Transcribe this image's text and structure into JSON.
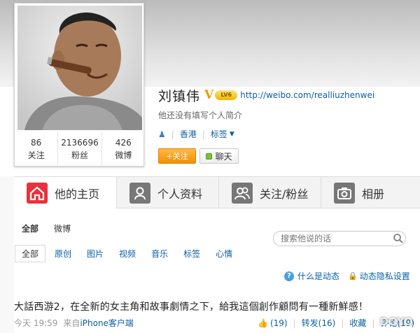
{
  "profile": {
    "name": "刘镇伟",
    "verified_badge": "V",
    "level_badge": "LV6",
    "url": "http://weibo.com/realliuzhenwei",
    "bio": "他还没有填写个人简介",
    "location": "香港",
    "tags_label": "标签",
    "follow_label": "+关注",
    "chat_label": "聊天"
  },
  "stats": [
    {
      "num": "86",
      "label": "关注"
    },
    {
      "num": "2136696",
      "label": "粉丝"
    },
    {
      "num": "426",
      "label": "微博"
    }
  ],
  "tabs": [
    {
      "label": "他的主页",
      "icon": "home-icon",
      "active": true
    },
    {
      "label": "个人资料",
      "icon": "profile-icon",
      "active": false
    },
    {
      "label": "关注/粉丝",
      "icon": "follow-fans-icon",
      "active": false
    },
    {
      "label": "相册",
      "icon": "camera-icon",
      "active": false
    }
  ],
  "feed": {
    "subnav": [
      "全部",
      "微博"
    ],
    "search_placeholder": "搜索他说的话",
    "filters": [
      "全部",
      "原创",
      "图片",
      "视频",
      "音乐",
      "标签",
      "心情"
    ],
    "help_link": "什么是动态",
    "privacy_link": "动态隐私设置"
  },
  "post": {
    "text": "大話西游2，在全新的女主角和故事劇情之下，給我這個創作顧問有一種新鮮感！",
    "time": "今天 19:59",
    "source_prefix": "来自",
    "source": "iPhone客户端",
    "likes": "(19)",
    "repost": "转发(16)",
    "favorite": "收藏",
    "comment": "评论(19)"
  },
  "watermark": "DOYO",
  "colors": {
    "link": "#0a5fa8",
    "follow": "#f38f00",
    "active_tab_icon": "#e8313b"
  }
}
